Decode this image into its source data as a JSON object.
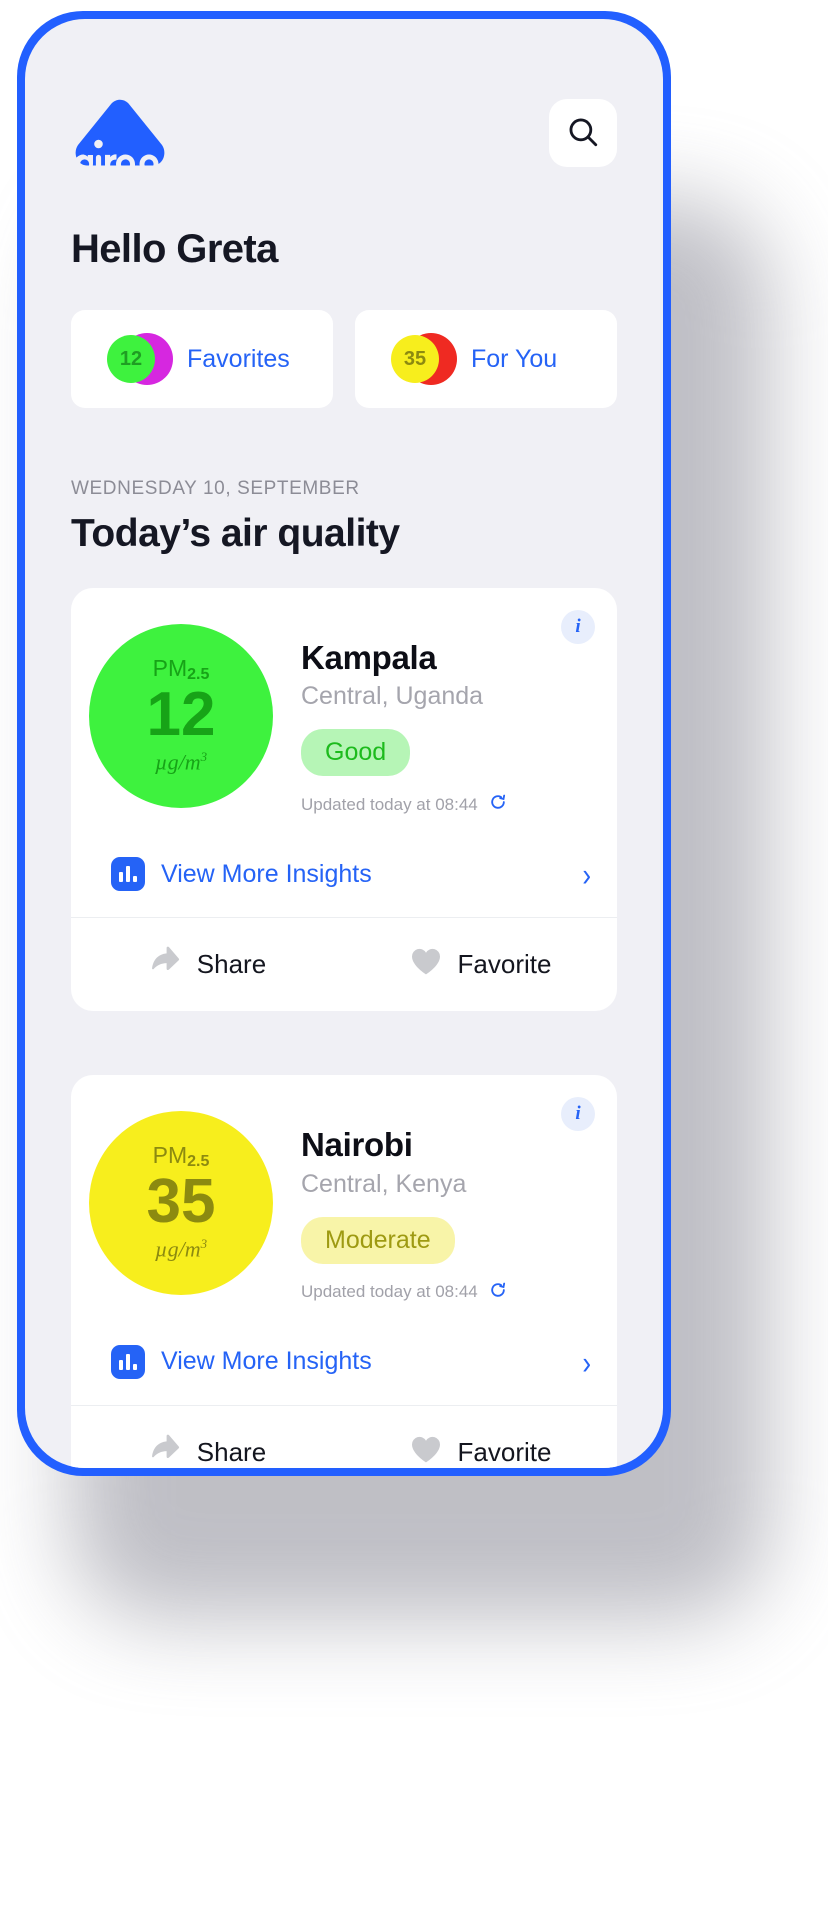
{
  "app": {
    "logo_text": "airqo",
    "brand_color": "#225fff"
  },
  "header": {
    "search_icon": "search-icon",
    "greeting": "Hello Greta"
  },
  "chips": [
    {
      "count": "12",
      "label": "Favorites",
      "disc_color": "#3ef23e",
      "disc_text_color": "#1f9e23",
      "crescent_color": "#d627e0"
    },
    {
      "count": "35",
      "label": "For You",
      "disc_color": "#f7ee1d",
      "disc_text_color": "#8c8a10",
      "crescent_color": "#ef2a22"
    }
  ],
  "section": {
    "date": "WEDNESDAY 10, SEPTEMBER",
    "title": "Today’s air quality"
  },
  "cards": [
    {
      "info_icon": "info-icon",
      "pm_label": "PM",
      "pm_subscript": "2.5",
      "pm_value": "12",
      "pm_unit": "µg/m",
      "pm_unit_sup": "3",
      "bubble_color": "#3ef23e",
      "bubble_text_color": "#17a317",
      "city": "Kampala",
      "region": "Central, Uganda",
      "status": "Good",
      "status_bg": "#b6f5b6",
      "status_color": "#1dbb1d",
      "updated": "Updated today at 08:44",
      "refresh_icon": "refresh-icon",
      "insights_label": "View More Insights",
      "chart_icon": "bar-chart-icon",
      "chevron_icon": "chevron-right-icon",
      "share_label": "Share",
      "share_icon": "share-arrow-icon",
      "favorite_label": "Favorite",
      "favorite_icon": "heart-icon"
    },
    {
      "info_icon": "info-icon",
      "pm_label": "PM",
      "pm_subscript": "2.5",
      "pm_value": "35",
      "pm_unit": "µg/m",
      "pm_unit_sup": "3",
      "bubble_color": "#f7ee1d",
      "bubble_text_color": "#8c8a10",
      "city": "Nairobi",
      "region": "Central, Kenya",
      "status": "Moderate",
      "status_bg": "#f8f4a8",
      "status_color": "#9e9a12",
      "updated": "Updated today at 08:44",
      "refresh_icon": "refresh-icon",
      "insights_label": "View More Insights",
      "chart_icon": "bar-chart-icon",
      "chevron_icon": "chevron-right-icon",
      "share_label": "Share",
      "share_icon": "share-arrow-icon",
      "favorite_label": "Favorite",
      "favorite_icon": "heart-icon"
    }
  ]
}
